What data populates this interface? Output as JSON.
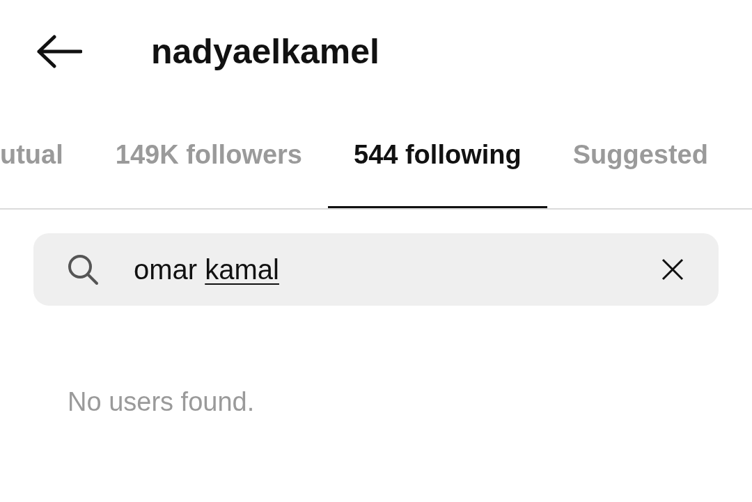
{
  "header": {
    "title": "nadyaelkamel"
  },
  "tabs": [
    {
      "label": "utual",
      "selected": false
    },
    {
      "label": "149K followers",
      "selected": false
    },
    {
      "label": "544 following",
      "selected": true
    },
    {
      "label": "Suggested",
      "selected": false
    }
  ],
  "search": {
    "value": "omar kamal",
    "last_word_underlined": true
  },
  "message": "No users found."
}
